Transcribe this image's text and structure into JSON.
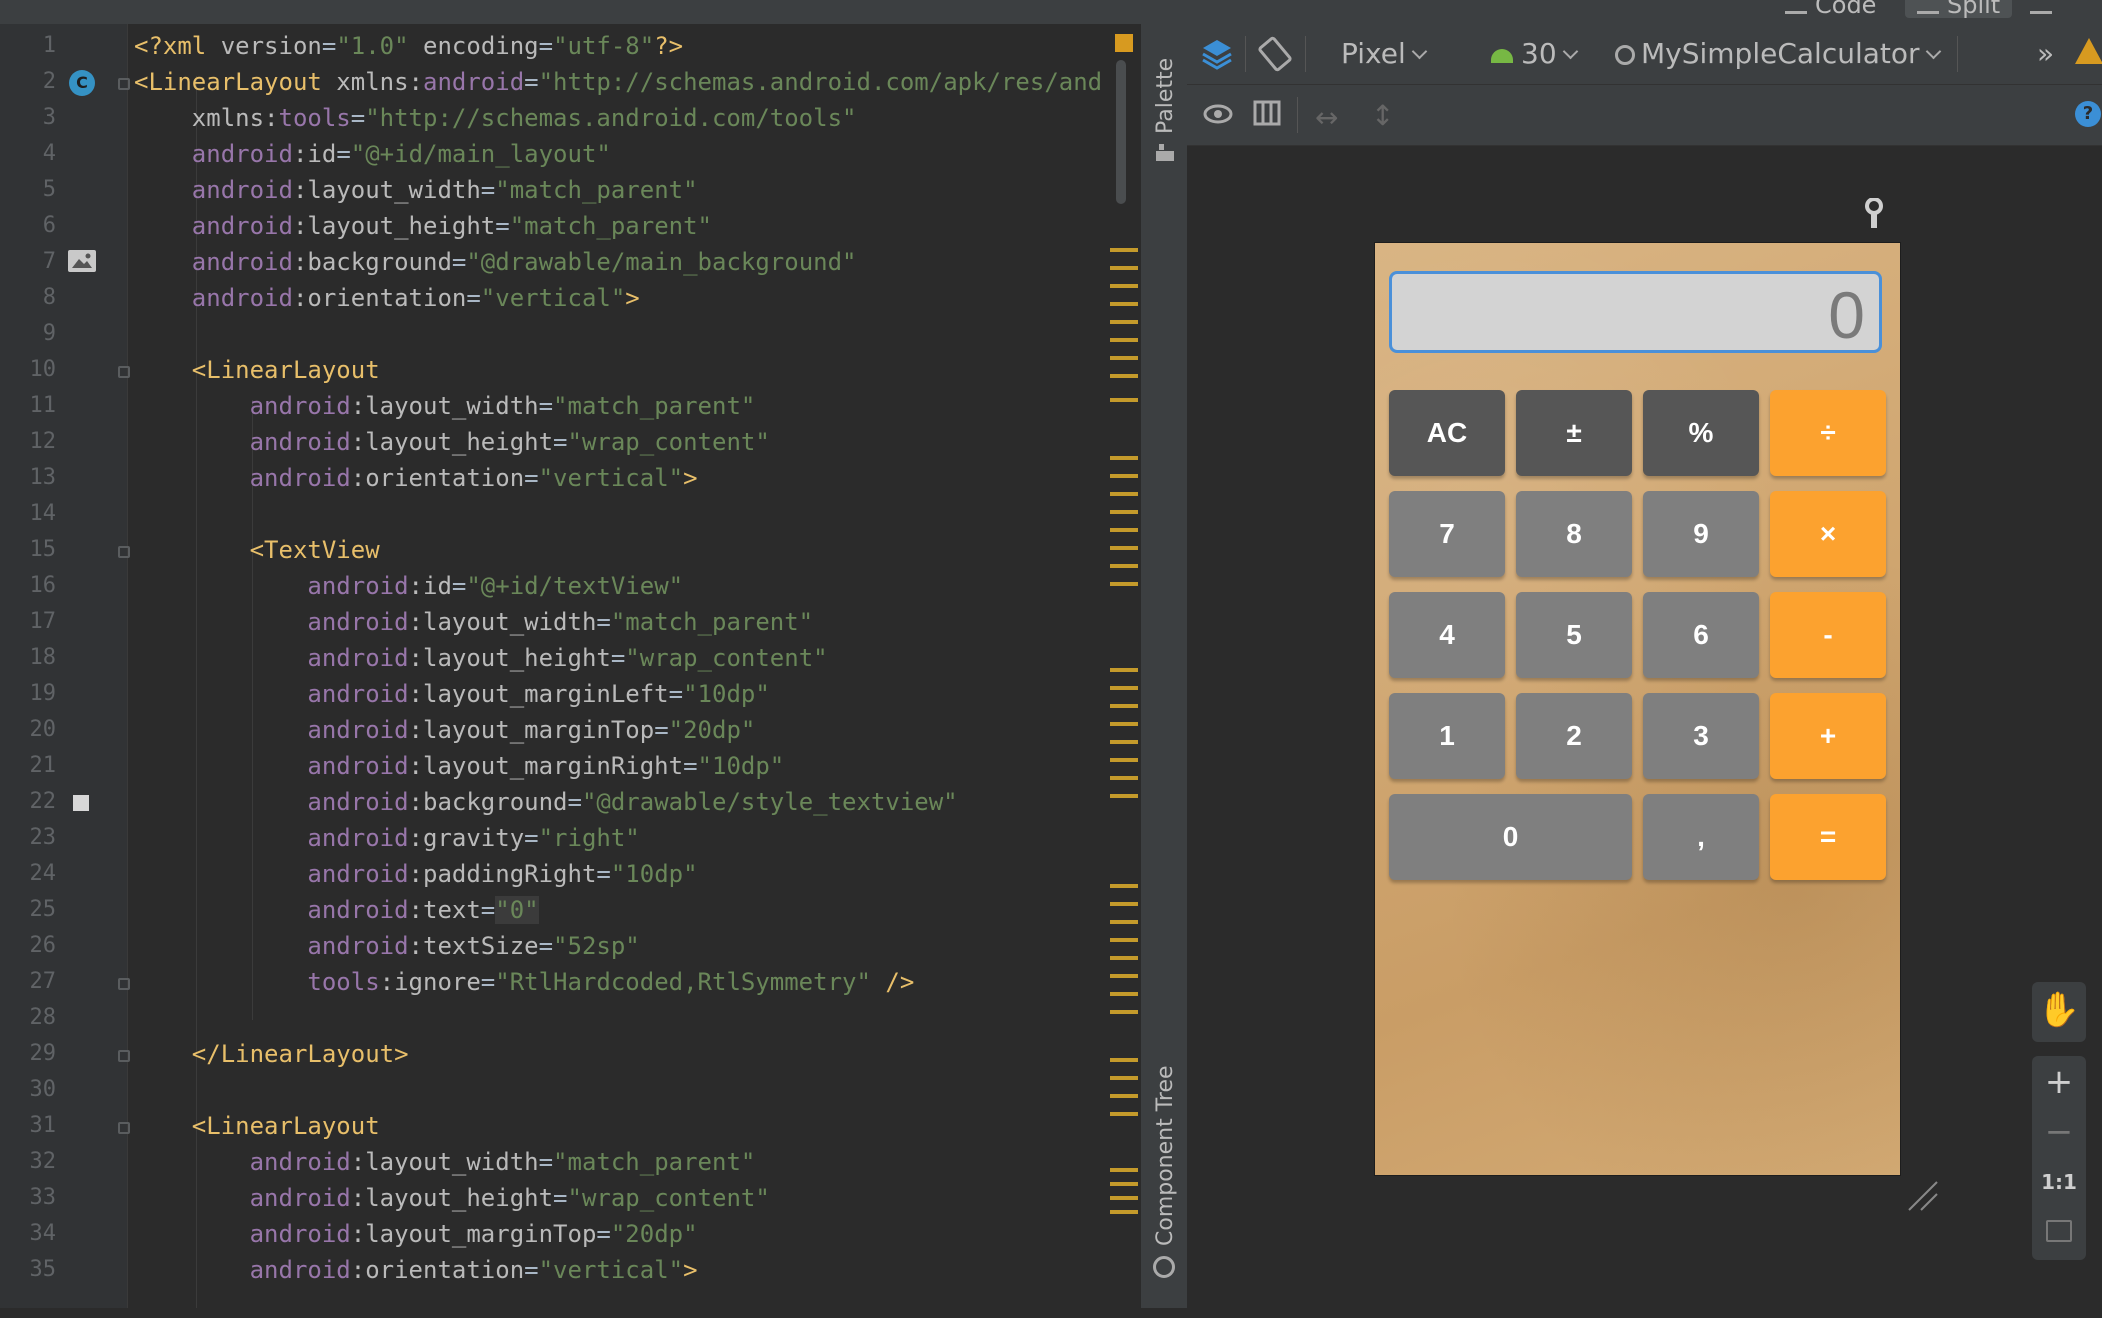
{
  "view_modes": [
    {
      "label": "Code"
    },
    {
      "label": "Split",
      "selected": true
    }
  ],
  "editor": {
    "line_numbers": [
      "1",
      "2",
      "3",
      "4",
      "5",
      "6",
      "7",
      "8",
      "9",
      "10",
      "11",
      "12",
      "13",
      "14",
      "15",
      "16",
      "17",
      "18",
      "19",
      "20",
      "21",
      "22",
      "23",
      "24",
      "25",
      "26",
      "27",
      "28",
      "29",
      "30",
      "31",
      "32",
      "33",
      "34",
      "35"
    ],
    "lines": [
      [
        {
          "c": "tag",
          "t": "<?xml "
        },
        {
          "c": "attr",
          "t": "version"
        },
        {
          "c": "tok",
          "t": "="
        },
        {
          "c": "val",
          "t": "\"1.0\""
        },
        {
          "c": "tok",
          "t": " "
        },
        {
          "c": "attr",
          "t": "encoding"
        },
        {
          "c": "tok",
          "t": "="
        },
        {
          "c": "val",
          "t": "\"utf-8\""
        },
        {
          "c": "tag",
          "t": "?>"
        }
      ],
      [
        {
          "c": "tag",
          "t": "<LinearLayout "
        },
        {
          "c": "attr",
          "t": "xmlns:"
        },
        {
          "c": "ns",
          "t": "android"
        },
        {
          "c": "tok",
          "t": "="
        },
        {
          "c": "val",
          "t": "\"http://schemas.android.com/apk/res/android\""
        }
      ],
      [
        {
          "c": "tok",
          "t": "    "
        },
        {
          "c": "attr",
          "t": "xmlns:"
        },
        {
          "c": "ns",
          "t": "tools"
        },
        {
          "c": "tok",
          "t": "="
        },
        {
          "c": "val",
          "t": "\"http://schemas.android.com/tools\""
        }
      ],
      [
        {
          "c": "tok",
          "t": "    "
        },
        {
          "c": "ns",
          "t": "android"
        },
        {
          "c": "attr",
          "t": ":id"
        },
        {
          "c": "tok",
          "t": "="
        },
        {
          "c": "val",
          "t": "\"@+id/main_layout\""
        }
      ],
      [
        {
          "c": "tok",
          "t": "    "
        },
        {
          "c": "ns",
          "t": "android"
        },
        {
          "c": "attr",
          "t": ":layout_width"
        },
        {
          "c": "tok",
          "t": "="
        },
        {
          "c": "val",
          "t": "\"match_parent\""
        }
      ],
      [
        {
          "c": "tok",
          "t": "    "
        },
        {
          "c": "ns",
          "t": "android"
        },
        {
          "c": "attr",
          "t": ":layout_height"
        },
        {
          "c": "tok",
          "t": "="
        },
        {
          "c": "val",
          "t": "\"match_parent\""
        }
      ],
      [
        {
          "c": "tok",
          "t": "    "
        },
        {
          "c": "ns",
          "t": "android"
        },
        {
          "c": "attr",
          "t": ":background"
        },
        {
          "c": "tok",
          "t": "="
        },
        {
          "c": "val",
          "t": "\"@drawable/main_background\""
        }
      ],
      [
        {
          "c": "tok",
          "t": "    "
        },
        {
          "c": "ns",
          "t": "android"
        },
        {
          "c": "attr",
          "t": ":orientation"
        },
        {
          "c": "tok",
          "t": "="
        },
        {
          "c": "val",
          "t": "\"vertical\""
        },
        {
          "c": "tag",
          "t": ">"
        }
      ],
      [],
      [
        {
          "c": "tok",
          "t": "    "
        },
        {
          "c": "tag",
          "t": "<LinearLayout"
        }
      ],
      [
        {
          "c": "tok",
          "t": "        "
        },
        {
          "c": "ns",
          "t": "android"
        },
        {
          "c": "attr",
          "t": ":layout_width"
        },
        {
          "c": "tok",
          "t": "="
        },
        {
          "c": "val",
          "t": "\"match_parent\""
        }
      ],
      [
        {
          "c": "tok",
          "t": "        "
        },
        {
          "c": "ns",
          "t": "android"
        },
        {
          "c": "attr",
          "t": ":layout_height"
        },
        {
          "c": "tok",
          "t": "="
        },
        {
          "c": "val",
          "t": "\"wrap_content\""
        }
      ],
      [
        {
          "c": "tok",
          "t": "        "
        },
        {
          "c": "ns",
          "t": "android"
        },
        {
          "c": "attr",
          "t": ":orientation"
        },
        {
          "c": "tok",
          "t": "="
        },
        {
          "c": "val",
          "t": "\"vertical\""
        },
        {
          "c": "tag",
          "t": ">"
        }
      ],
      [],
      [
        {
          "c": "tok",
          "t": "        "
        },
        {
          "c": "tag",
          "t": "<TextView"
        }
      ],
      [
        {
          "c": "tok",
          "t": "            "
        },
        {
          "c": "ns",
          "t": "android"
        },
        {
          "c": "attr",
          "t": ":id"
        },
        {
          "c": "tok",
          "t": "="
        },
        {
          "c": "val",
          "t": "\"@+id/textView\""
        }
      ],
      [
        {
          "c": "tok",
          "t": "            "
        },
        {
          "c": "ns",
          "t": "android"
        },
        {
          "c": "attr",
          "t": ":layout_width"
        },
        {
          "c": "tok",
          "t": "="
        },
        {
          "c": "val",
          "t": "\"match_parent\""
        }
      ],
      [
        {
          "c": "tok",
          "t": "            "
        },
        {
          "c": "ns",
          "t": "android"
        },
        {
          "c": "attr",
          "t": ":layout_height"
        },
        {
          "c": "tok",
          "t": "="
        },
        {
          "c": "val",
          "t": "\"wrap_content\""
        }
      ],
      [
        {
          "c": "tok",
          "t": "            "
        },
        {
          "c": "ns",
          "t": "android"
        },
        {
          "c": "attr",
          "t": ":layout_marginLeft"
        },
        {
          "c": "tok",
          "t": "="
        },
        {
          "c": "val",
          "t": "\"10dp\""
        }
      ],
      [
        {
          "c": "tok",
          "t": "            "
        },
        {
          "c": "ns",
          "t": "android"
        },
        {
          "c": "attr",
          "t": ":layout_marginTop"
        },
        {
          "c": "tok",
          "t": "="
        },
        {
          "c": "val",
          "t": "\"20dp\""
        }
      ],
      [
        {
          "c": "tok",
          "t": "            "
        },
        {
          "c": "ns",
          "t": "android"
        },
        {
          "c": "attr",
          "t": ":layout_marginRight"
        },
        {
          "c": "tok",
          "t": "="
        },
        {
          "c": "val",
          "t": "\"10dp\""
        }
      ],
      [
        {
          "c": "tok",
          "t": "            "
        },
        {
          "c": "ns",
          "t": "android"
        },
        {
          "c": "attr",
          "t": ":background"
        },
        {
          "c": "tok",
          "t": "="
        },
        {
          "c": "val",
          "t": "\"@drawable/style_textview\""
        }
      ],
      [
        {
          "c": "tok",
          "t": "            "
        },
        {
          "c": "ns",
          "t": "android"
        },
        {
          "c": "attr",
          "t": ":gravity"
        },
        {
          "c": "tok",
          "t": "="
        },
        {
          "c": "val",
          "t": "\"right\""
        }
      ],
      [
        {
          "c": "tok",
          "t": "            "
        },
        {
          "c": "ns",
          "t": "android"
        },
        {
          "c": "attr",
          "t": ":paddingRight"
        },
        {
          "c": "tok",
          "t": "="
        },
        {
          "c": "val",
          "t": "\"10dp\""
        }
      ],
      [
        {
          "c": "tok",
          "t": "            "
        },
        {
          "c": "ns",
          "t": "android"
        },
        {
          "c": "attr",
          "t": ":text"
        },
        {
          "c": "tok",
          "t": "="
        },
        {
          "c": "val hl",
          "t": "\"0\""
        }
      ],
      [
        {
          "c": "tok",
          "t": "            "
        },
        {
          "c": "ns",
          "t": "android"
        },
        {
          "c": "attr",
          "t": ":textSize"
        },
        {
          "c": "tok",
          "t": "="
        },
        {
          "c": "val",
          "t": "\"52sp\""
        }
      ],
      [
        {
          "c": "tok",
          "t": "            "
        },
        {
          "c": "ns",
          "t": "tools"
        },
        {
          "c": "attr",
          "t": ":ignore"
        },
        {
          "c": "tok",
          "t": "="
        },
        {
          "c": "val",
          "t": "\"RtlHardcoded,RtlSymmetry\""
        },
        {
          "c": "tok",
          "t": " "
        },
        {
          "c": "tag",
          "t": "/>"
        }
      ],
      [],
      [
        {
          "c": "tok",
          "t": "    "
        },
        {
          "c": "tag",
          "t": "</LinearLayout>"
        }
      ],
      [],
      [
        {
          "c": "tok",
          "t": "    "
        },
        {
          "c": "tag",
          "t": "<LinearLayout"
        }
      ],
      [
        {
          "c": "tok",
          "t": "        "
        },
        {
          "c": "ns",
          "t": "android"
        },
        {
          "c": "attr",
          "t": ":layout_width"
        },
        {
          "c": "tok",
          "t": "="
        },
        {
          "c": "val",
          "t": "\"match_parent\""
        }
      ],
      [
        {
          "c": "tok",
          "t": "        "
        },
        {
          "c": "ns",
          "t": "android"
        },
        {
          "c": "attr",
          "t": ":layout_height"
        },
        {
          "c": "tok",
          "t": "="
        },
        {
          "c": "val",
          "t": "\"wrap_content\""
        }
      ],
      [
        {
          "c": "tok",
          "t": "        "
        },
        {
          "c": "ns",
          "t": "android"
        },
        {
          "c": "attr",
          "t": ":layout_marginTop"
        },
        {
          "c": "tok",
          "t": "="
        },
        {
          "c": "val",
          "t": "\"20dp\""
        }
      ],
      [
        {
          "c": "tok",
          "t": "        "
        },
        {
          "c": "ns",
          "t": "android"
        },
        {
          "c": "attr",
          "t": ":orientation"
        },
        {
          "c": "tok",
          "t": "="
        },
        {
          "c": "val",
          "t": "\"vertical\""
        },
        {
          "c": "tag",
          "t": ">"
        }
      ]
    ]
  },
  "side_panels": {
    "palette": "Palette",
    "component_tree": "Component Tree"
  },
  "design_toolbar": {
    "device": "Pixel",
    "api_level": "30",
    "theme": "MySimpleCalculator",
    "more": "»"
  },
  "preview": {
    "display_value": "0",
    "buttons": [
      {
        "label": "AC",
        "style": "dark"
      },
      {
        "label": "±",
        "style": "dark"
      },
      {
        "label": "%",
        "style": "dark"
      },
      {
        "label": "÷",
        "style": "orange"
      },
      {
        "label": "7",
        "style": "grey"
      },
      {
        "label": "8",
        "style": "grey"
      },
      {
        "label": "9",
        "style": "grey"
      },
      {
        "label": "×",
        "style": "orange"
      },
      {
        "label": "4",
        "style": "grey"
      },
      {
        "label": "5",
        "style": "grey"
      },
      {
        "label": "6",
        "style": "grey"
      },
      {
        "label": "-",
        "style": "orange"
      },
      {
        "label": "1",
        "style": "grey"
      },
      {
        "label": "2",
        "style": "grey"
      },
      {
        "label": "3",
        "style": "grey"
      },
      {
        "label": "+",
        "style": "orange"
      },
      {
        "label": "0",
        "style": "grey",
        "wide": true
      },
      {
        "label": ",",
        "style": "grey"
      },
      {
        "label": "=",
        "style": "orange"
      }
    ]
  },
  "zoom_controls": {
    "plus": "+",
    "minus": "−",
    "actual_size": "1:1"
  },
  "colors": {
    "accent_orange": "#fca22f",
    "display_border": "#4a90d9",
    "button_dark": "#565656",
    "button_grey": "#7f7f7f"
  }
}
